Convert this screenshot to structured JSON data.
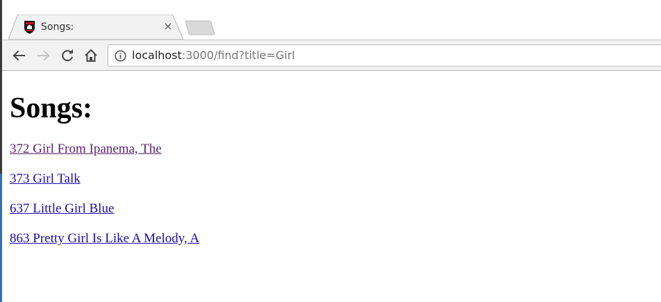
{
  "tab": {
    "title": "Songs:",
    "close_glyph": "×"
  },
  "omnibox": {
    "host": "localhost",
    "rest": ":3000/find?title=Girl"
  },
  "page": {
    "heading": "Songs:",
    "songs": [
      {
        "label": "372 Girl From Ipanema, The",
        "visited": true
      },
      {
        "label": "373 Girl Talk",
        "visited": false
      },
      {
        "label": "637 Little Girl Blue",
        "visited": false
      },
      {
        "label": "863 Pretty Girl Is Like A Melody, A",
        "visited": false
      }
    ]
  },
  "colors": {
    "link": "#1a0dab",
    "visited_link": "#5c1f73",
    "toolbar_bg": "#f2f2f2"
  },
  "icons": {
    "favicon": "shield-favicon-icon",
    "back": "arrow-left-icon",
    "forward": "arrow-right-icon",
    "reload": "reload-icon",
    "home": "home-icon",
    "info": "info-icon",
    "close": "close-icon",
    "new_tab": "new-tab-icon"
  }
}
